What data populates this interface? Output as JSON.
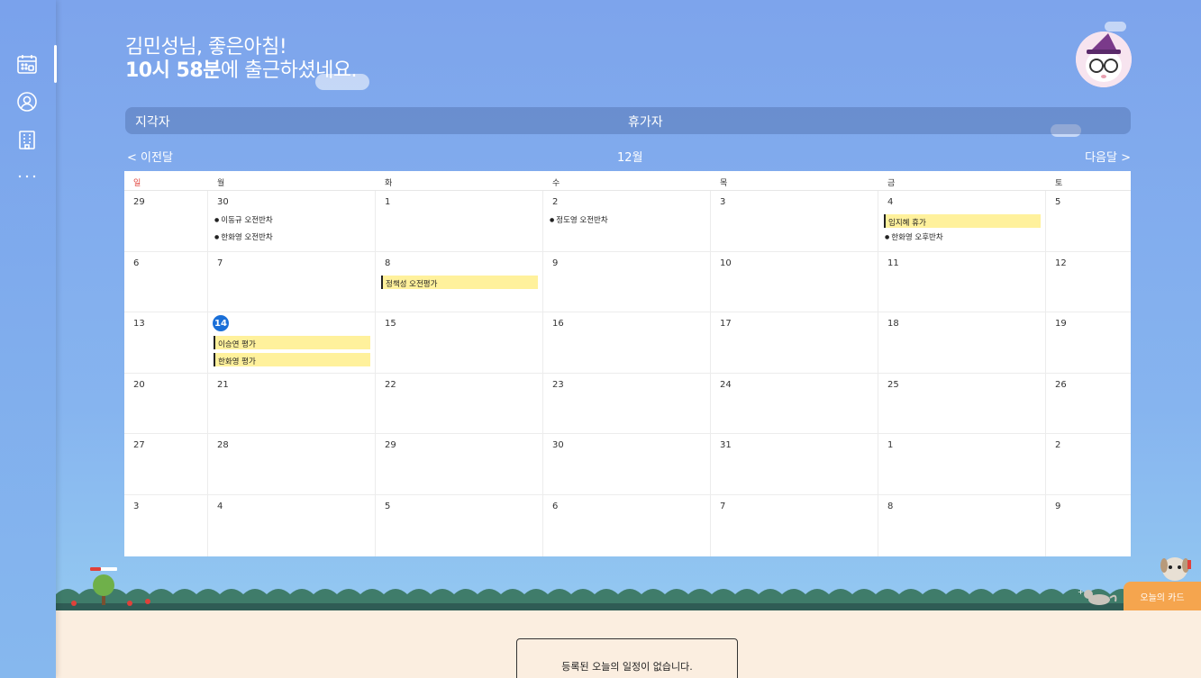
{
  "greeting": {
    "line1": "김민성님, 좋은아침!",
    "time_prefix": "10시 58분",
    "time_suffix": "에 출근하셨네요."
  },
  "status_bar": {
    "late_label": "지각자",
    "vacation_label": "휴가자"
  },
  "month_nav": {
    "prev": "< 이전달",
    "current": "12월",
    "next": "다음달 >"
  },
  "weekdays": [
    "일",
    "월",
    "화",
    "수",
    "목",
    "금",
    "토"
  ],
  "weeks": [
    {
      "days": [
        {
          "n": "29",
          "events": []
        },
        {
          "n": "30",
          "events": [
            {
              "type": "dot",
              "text": "이동규 오전반차"
            },
            {
              "type": "dot",
              "text": "한화영 오전반차"
            }
          ]
        },
        {
          "n": "1",
          "events": []
        },
        {
          "n": "2",
          "events": [
            {
              "type": "dot",
              "text": "정도영 오전반차"
            }
          ]
        },
        {
          "n": "3",
          "events": []
        },
        {
          "n": "4",
          "events": [
            {
              "type": "bar",
              "text": "임지혜 휴가"
            },
            {
              "type": "dot",
              "text": "한화영 오후반차"
            }
          ]
        },
        {
          "n": "5",
          "events": []
        }
      ]
    },
    {
      "days": [
        {
          "n": "6",
          "events": []
        },
        {
          "n": "7",
          "events": []
        },
        {
          "n": "8",
          "events": [
            {
              "type": "bar",
              "text": "정책성 오전평가"
            }
          ]
        },
        {
          "n": "9",
          "events": []
        },
        {
          "n": "10",
          "events": []
        },
        {
          "n": "11",
          "events": []
        },
        {
          "n": "12",
          "events": []
        }
      ]
    },
    {
      "days": [
        {
          "n": "13",
          "events": []
        },
        {
          "n": "14",
          "today": true,
          "events": [
            {
              "type": "bar",
              "text": "이승연 평가"
            },
            {
              "type": "bar",
              "text": "한화영 평가"
            }
          ]
        },
        {
          "n": "15",
          "events": []
        },
        {
          "n": "16",
          "events": []
        },
        {
          "n": "17",
          "events": []
        },
        {
          "n": "18",
          "events": []
        },
        {
          "n": "19",
          "events": []
        }
      ]
    },
    {
      "days": [
        {
          "n": "20",
          "events": []
        },
        {
          "n": "21",
          "events": []
        },
        {
          "n": "22",
          "events": []
        },
        {
          "n": "23",
          "events": []
        },
        {
          "n": "24",
          "events": []
        },
        {
          "n": "25",
          "events": []
        },
        {
          "n": "26",
          "events": []
        }
      ]
    },
    {
      "days": [
        {
          "n": "27",
          "events": []
        },
        {
          "n": "28",
          "events": []
        },
        {
          "n": "29",
          "events": []
        },
        {
          "n": "30",
          "events": []
        },
        {
          "n": "31",
          "events": []
        },
        {
          "n": "1",
          "events": []
        },
        {
          "n": "2",
          "events": []
        }
      ]
    },
    {
      "days": [
        {
          "n": "3",
          "events": []
        },
        {
          "n": "4",
          "events": []
        },
        {
          "n": "5",
          "events": []
        },
        {
          "n": "6",
          "events": []
        },
        {
          "n": "7",
          "events": []
        },
        {
          "n": "8",
          "events": []
        },
        {
          "n": "9",
          "events": []
        }
      ]
    }
  ],
  "today_schedule": {
    "empty_message": "등록된 오늘의 일정이 없습니다."
  },
  "today_card_button": "오늘의 카드",
  "sidebar": {
    "icons": [
      "calendar-icon",
      "user-icon",
      "building-icon",
      "more-icon"
    ]
  },
  "colors": {
    "bg": "#7ea6ec",
    "event_highlight": "#fff19c",
    "today": "#1a6fd8",
    "sunday": "#e0413a",
    "card_button": "#f5a54e"
  }
}
